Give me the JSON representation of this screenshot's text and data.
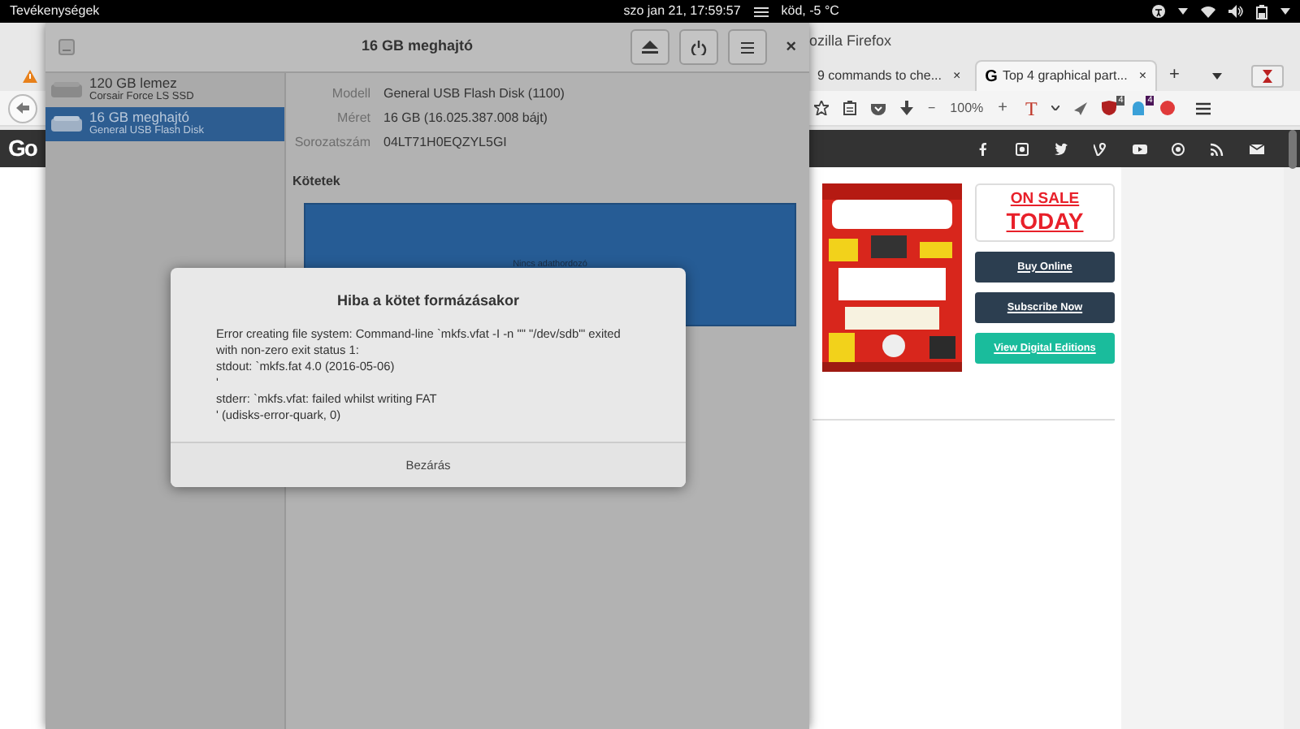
{
  "top_bar": {
    "activities": "Tevékenységek",
    "clock": "szo jan 21, 17:59:57",
    "weather": "köd, -5 °C"
  },
  "firefox": {
    "title": "ozilla Firefox",
    "logo": "Go",
    "zoom": "100%",
    "zoom_out": "−",
    "zoom_in": "+",
    "text_tool": "T",
    "new_tab": "+",
    "tabs": [
      {
        "title": "9 commands to che...",
        "close": "×",
        "selected": false
      },
      {
        "title": "Top 4 graphical part...",
        "favicon": "G",
        "close": "×",
        "selected": true
      }
    ],
    "badges": [
      "4",
      "4"
    ],
    "ad": {
      "headline": "ON SALE",
      "subline": "TODAY",
      "buttons": [
        {
          "label": "Buy Online",
          "kind": "dark"
        },
        {
          "label": "Subscribe Now",
          "kind": "dark"
        },
        {
          "label": "View Digital Editions",
          "kind": "teal"
        }
      ]
    }
  },
  "disks": {
    "title": "16 GB meghajtó",
    "close": "×",
    "drives": [
      {
        "name": "120 GB lemez",
        "model": "Corsair Force LS SSD",
        "selected": false
      },
      {
        "name": "16 GB meghajtó",
        "model": "General USB Flash Disk",
        "selected": true
      }
    ],
    "details": [
      {
        "label": "Modell",
        "value": "General USB Flash Disk (1100)"
      },
      {
        "label": "Méret",
        "value": "16 GB (16.025.387.008 bájt)"
      },
      {
        "label": "Sorozatszám",
        "value": "04LT71H0EQZYL5GI"
      }
    ],
    "volumes_heading": "Kötetek",
    "volume_label": "Nincs adathordozó"
  },
  "dialog": {
    "title": "Hiba a kötet formázásakor",
    "message": [
      "Error creating file system: Command-line `mkfs.vfat -I -n \"\" \"/dev/sdb\"' exited with non-zero exit status 1:",
      "stdout: `mkfs.fat 4.0 (2016-05-06)",
      "'",
      "stderr: `mkfs.vfat: failed whilst writing FAT",
      "' (udisks-error-quark, 0)"
    ],
    "button": "Bezárás"
  }
}
